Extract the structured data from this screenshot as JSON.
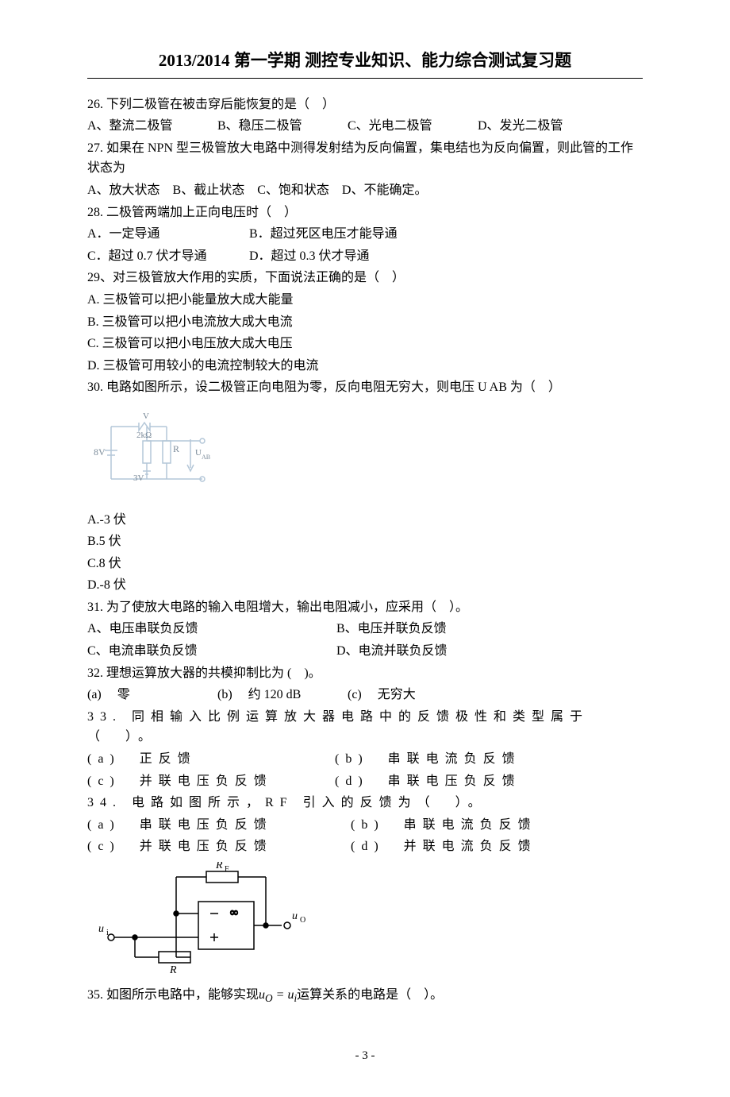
{
  "header": "2013/2014 第一学期 测控专业知识、能力综合测试复习题",
  "q26": {
    "stem": "26. 下列二极管在被击穿后能恢复的是（　）",
    "A": "A、整流二极管",
    "B": "B、稳压二极管",
    "C": "C、光电二极管",
    "D": "D、发光二极管"
  },
  "q27": {
    "stem": "27. 如果在 NPN 型三极管放大电路中测得发射结为反向偏置，集电结也为反向偏置，则此管的工作状态为",
    "opts": "A、放大状态　B、截止状态　C、饱和状态　D、不能确定。"
  },
  "q28": {
    "stem": "28. 二极管两端加上正向电压时（　）",
    "A": "A．一定导通",
    "B": "B．超过死区电压才能导通",
    "C": "C．超过 0.7 伏才导通",
    "D": "D．超过 0.3 伏才导通"
  },
  "q29": {
    "stem": "29、对三极管放大作用的实质，下面说法正确的是（　）",
    "A": "A. 三极管可以把小能量放大成大能量",
    "B": "B. 三极管可以把小电流放大成大电流",
    "C": "C. 三极管可以把小电压放大成大电压",
    "D": "D. 三极管可用较小的电流控制较大的电流"
  },
  "q30": {
    "stem": "30. 电路如图所示，设二极管正向电阻为零，反向电阻无穷大，则电压 U AB 为（　）",
    "diagram": {
      "v": "V",
      "r2k": "2kΩ",
      "R": "R",
      "vs": "8V",
      "vref": "3V",
      "uab": "U_AB"
    },
    "A": "A.-3 伏",
    "B": "B.5 伏",
    "C": "C.8 伏",
    "D": "D.-8 伏"
  },
  "q31": {
    "stem": "31. 为了使放大电路的输入电阻增大，输出电阻减小，应采用（　）。",
    "A": "A、电压串联负反馈",
    "B": "B、电压并联负反馈",
    "C": "C、电流串联负反馈",
    "D": "D、电流并联负反馈"
  },
  "q32": {
    "stem": "32. 理想运算放大器的共模抑制比为 (　)。",
    "a": "(a)　 零",
    "b": "(b)　 约 120 dB",
    "c": "(c)　 无穷大"
  },
  "q33": {
    "stem": "33. 同相输入比例运算放大器电路中的反馈极性和类型属于（　）。",
    "a": "(a)　正反馈",
    "b": "(b)　串联电流负反馈",
    "c": "(c)　并联电压负反馈",
    "d": "(d)　串联电压负反馈"
  },
  "q34": {
    "stem": "34. 电路如图所示，RF 引入的反馈为（　）。",
    "a": "(a)　串联电压负反馈",
    "b": "(b)　串联电流负反馈",
    "c": "(c)　并联电压负反馈",
    "d": "(d)　并联电流负反馈",
    "diagram": {
      "rf": "R_F",
      "ui": "u_i",
      "uo": "u_O",
      "R": "R"
    }
  },
  "q35": {
    "stem_pre": "35. 如图所示电路中，能够实现",
    "equation": "u_O = u_i",
    "stem_post": "运算关系的电路是（　）。"
  },
  "footer": "- 3 -"
}
